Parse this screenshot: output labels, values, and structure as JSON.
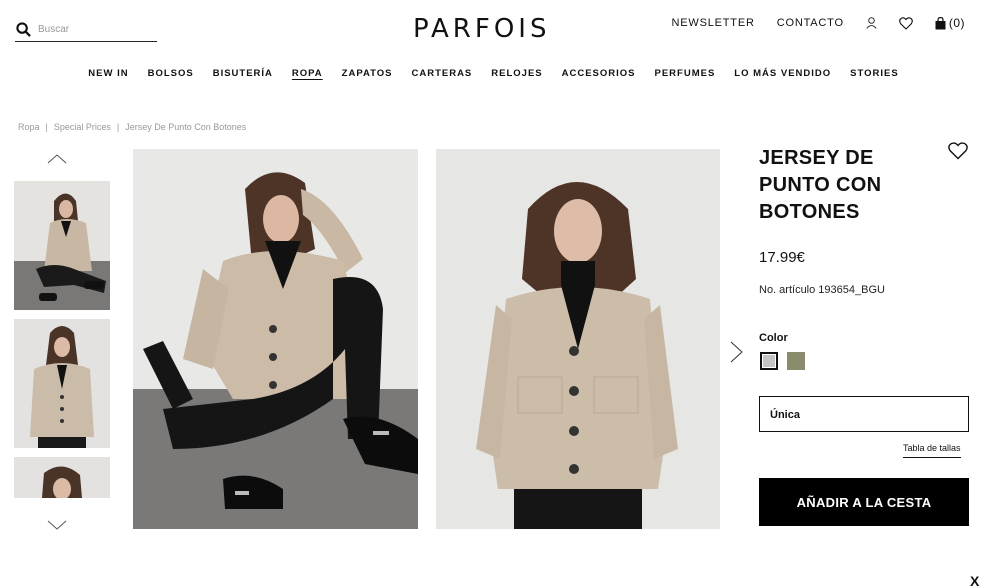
{
  "header": {
    "search_placeholder": "Buscar",
    "logo": "PARFOIS",
    "newsletter": "NEWSLETTER",
    "contacto": "CONTACTO",
    "bag_count": "(0)"
  },
  "nav": {
    "items": [
      "NEW IN",
      "BOLSOS",
      "BISUTERÍA",
      "ROPA",
      "ZAPATOS",
      "CARTERAS",
      "RELOJES",
      "ACCESORIOS",
      "PERFUMES",
      "LO MÁS VENDIDO",
      "STORIES"
    ],
    "active": "ROPA"
  },
  "breadcrumb": [
    "Ropa",
    "Special Prices",
    "Jersey De Punto Con Botones"
  ],
  "product": {
    "title": "JERSEY DE PUNTO CON BOTONES",
    "price": "17.99€",
    "sku": "No. artículo 193654_BGU",
    "color_label": "Color",
    "size": "Única",
    "size_table": "Tabla de tallas",
    "add_to_cart": "AÑADIR A LA CESTA"
  },
  "colors": {
    "swatch_grey": "#c6c4c2",
    "swatch_olive": "#8a8b6a",
    "button_bg": "#000000"
  },
  "close_label": "X"
}
